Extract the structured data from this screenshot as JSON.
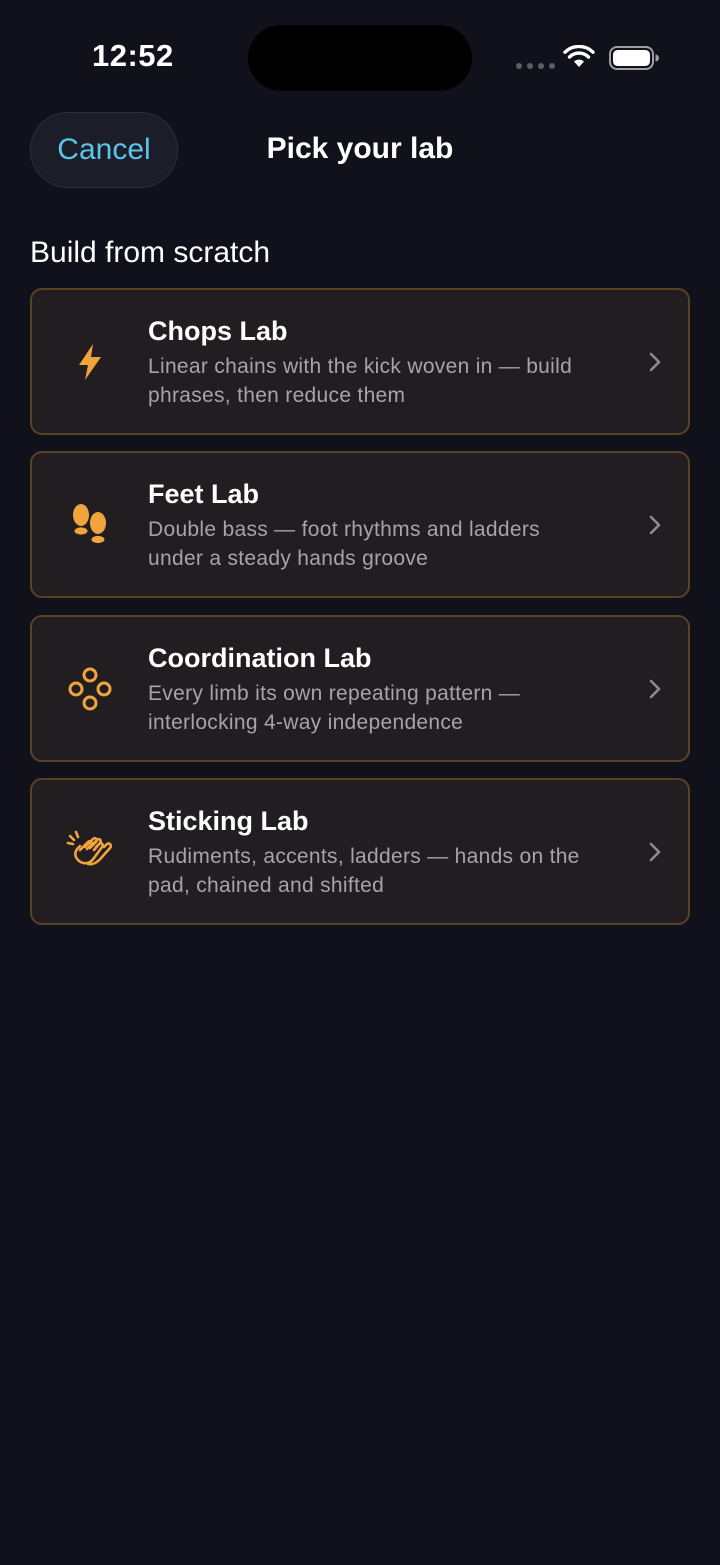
{
  "status_bar": {
    "time": "12:52"
  },
  "nav": {
    "cancel_label": "Cancel",
    "title": "Pick your lab"
  },
  "section": {
    "heading": "Build from scratch"
  },
  "labs": [
    {
      "icon": "lightning-bolt-icon",
      "title": "Chops Lab",
      "description": "Linear chains with the kick woven in — build phrases, then reduce them"
    },
    {
      "icon": "footprints-icon",
      "title": "Feet Lab",
      "description": "Double bass — foot rhythms and ladders under a steady hands groove"
    },
    {
      "icon": "four-circles-icon",
      "title": "Coordination Lab",
      "description": "Every limb its own repeating pattern — interlocking 4-way independence"
    },
    {
      "icon": "clapping-hands-icon",
      "title": "Sticking Lab",
      "description": "Rudiments, accents, ladders — hands on the pad, chained and shifted"
    }
  ],
  "colors": {
    "background": "#10111b",
    "accent_icon": "#f0a43c",
    "cancel_text": "#5cc4e8",
    "card_border": "#584323",
    "card_background": "#211d20"
  }
}
